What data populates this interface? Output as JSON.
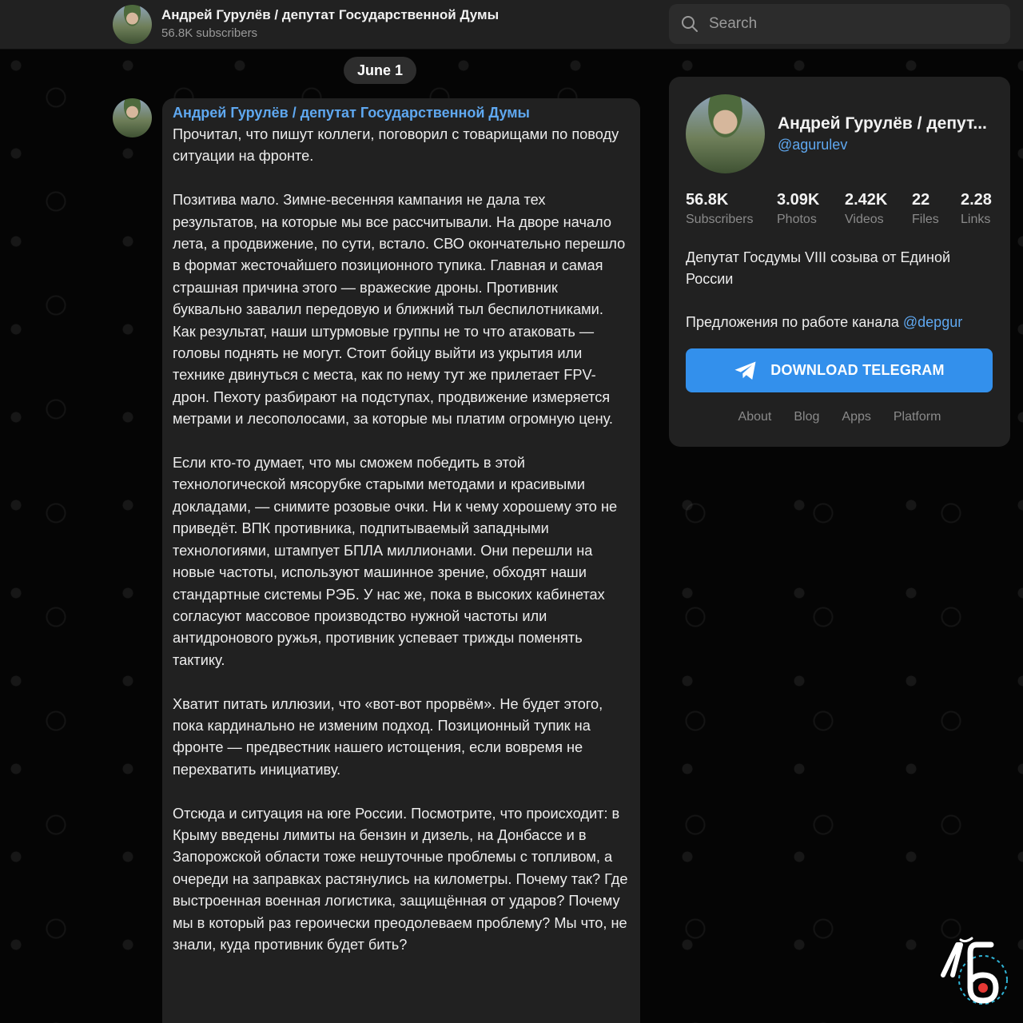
{
  "header": {
    "channel_title": "Андрей Гурулёв / депутат Государственной Думы",
    "subscribers": "56.8K subscribers",
    "search_placeholder": "Search"
  },
  "date_pill": "June 1",
  "post": {
    "author": "Андрей Гурулёв / депутат Государственной Думы",
    "paragraphs": [
      "Прочитал, что пишут коллеги, поговорил с товарищами по поводу ситуации на фронте.",
      "Позитива мало. Зимне-весенняя кампания не дала тех результатов, на которые мы все рассчитывали. На дворе начало лета, а продвижение, по сути, встало. СВО окончательно перешло в формат жесточайшего позиционного тупика. Главная и самая страшная причина этого — вражеские дроны. Противник буквально завалил передовую и ближний тыл беспилотниками. Как результат, наши штурмовые группы не то что атаковать — головы поднять не могут. Стоит бойцу выйти из укрытия или технике двинуться с места, как по нему тут же прилетает FPV-дрон. Пехоту разбирают на подступах, продвижение измеряется метрами и лесополосами, за которые мы платим огромную цену.",
      "Если кто-то думает, что мы сможем победить в этой технологической мясорубке старыми методами и красивыми докладами, — снимите розовые очки. Ни к чему хорошему это не приведёт. ВПК противника, подпитываемый западными технологиями, штампует БПЛА миллионами. Они перешли на новые частоты, используют машинное зрение, обходят наши стандартные системы РЭБ. У нас же, пока в высоких кабинетах согласуют массовое производство нужной частоты или антидронового ружья, противник успевает трижды поменять тактику.",
      "Хватит питать иллюзии, что «вот-вот прорвём». Не будет этого, пока кардинально не изменим подход. Позиционный тупик на фронте — предвестник нашего истощения, если вовремя не перехватить инициативу.",
      "Отсюда и ситуация на юге России. Посмотрите, что происходит: в Крыму введены лимиты на бензин и дизель, на Донбассе и в Запорожской области тоже нешуточные проблемы с топливом, а очереди на заправках растянулись на километры. Почему так? Где выстроенная военная логистика, защищённая от ударов? Почему мы в который раз героически преодолеваем проблему? Мы что, не знали, куда противник будет бить?"
    ]
  },
  "card": {
    "title": "Андрей Гурулёв / депут...",
    "handle": "@agurulev",
    "stats": [
      {
        "value": "56.8K",
        "label": "Subscribers"
      },
      {
        "value": "3.09K",
        "label": "Photos"
      },
      {
        "value": "2.42K",
        "label": "Videos"
      },
      {
        "value": "22",
        "label": "Files"
      },
      {
        "value": "2.28",
        "label": "Links"
      }
    ],
    "description": "Депутат Госдумы VIII созыва от Единой России",
    "suggest_text": "Предложения по работе канала ",
    "suggest_link": "@depgur",
    "download_label": "DOWNLOAD TELEGRAM",
    "footer_links": [
      "About",
      "Blog",
      "Apps",
      "Platform"
    ]
  },
  "colors": {
    "accent": "#3390ec",
    "link": "#5fa8f0",
    "panel": "#212121",
    "background": "#000000"
  },
  "icons": {
    "search": "search-icon",
    "download": "paper-plane-icon",
    "watermark": "lb-logo-icon"
  }
}
